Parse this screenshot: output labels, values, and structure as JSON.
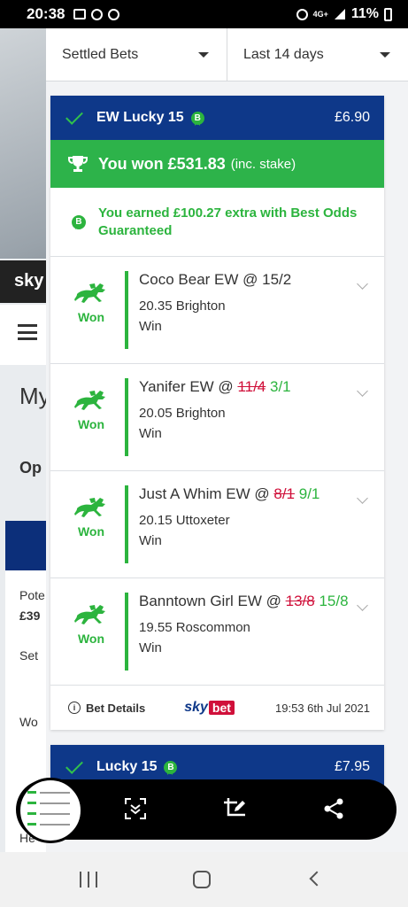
{
  "status": {
    "time": "20:38",
    "signal": "4G+",
    "battery": "11%"
  },
  "background": {
    "brand": "sky",
    "title": "My",
    "tab": "Op",
    "pot_label": "Pote",
    "pot_value": "£39",
    "set_label": "Set",
    "wo_label": "Wo",
    "hint": "He"
  },
  "filters": {
    "type": "Settled Bets",
    "period": "Last 14 days"
  },
  "bet": {
    "title": "EW Lucky 15",
    "badge": "B",
    "amount": "£6.90",
    "won_text": "You won £531.83",
    "won_sub": "(inc. stake)",
    "bog_text": "You earned £100.27 extra with Best Odds Guaranteed",
    "selections": [
      {
        "status": "Won",
        "name": "Coco Bear EW @",
        "old_odds": "",
        "odds": "15/2",
        "race": "20.35 Brighton",
        "result": "Win"
      },
      {
        "status": "Won",
        "name": "Yanifer EW @",
        "old_odds": "11/4",
        "odds": "3/1",
        "race": "20.05 Brighton",
        "result": "Win"
      },
      {
        "status": "Won",
        "name": "Just A Whim EW @",
        "old_odds": "8/1",
        "odds": "9/1",
        "race": "20.15 Uttoxeter",
        "result": "Win"
      },
      {
        "status": "Won",
        "name": "Banntown Girl EW @",
        "old_odds": "13/8",
        "odds": "15/8",
        "race": "19.55 Roscommon",
        "result": "Win"
      }
    ],
    "details_label": "Bet Details",
    "logo_sky": "sky",
    "logo_bet": "bet",
    "date": "19:53 6th Jul 2021"
  },
  "next_bet": {
    "title": "Lucky 15",
    "badge": "B",
    "amount": "£7.95"
  },
  "colors": {
    "header_blue": "#0e3889",
    "green": "#2db34a",
    "red": "#d0103a"
  }
}
